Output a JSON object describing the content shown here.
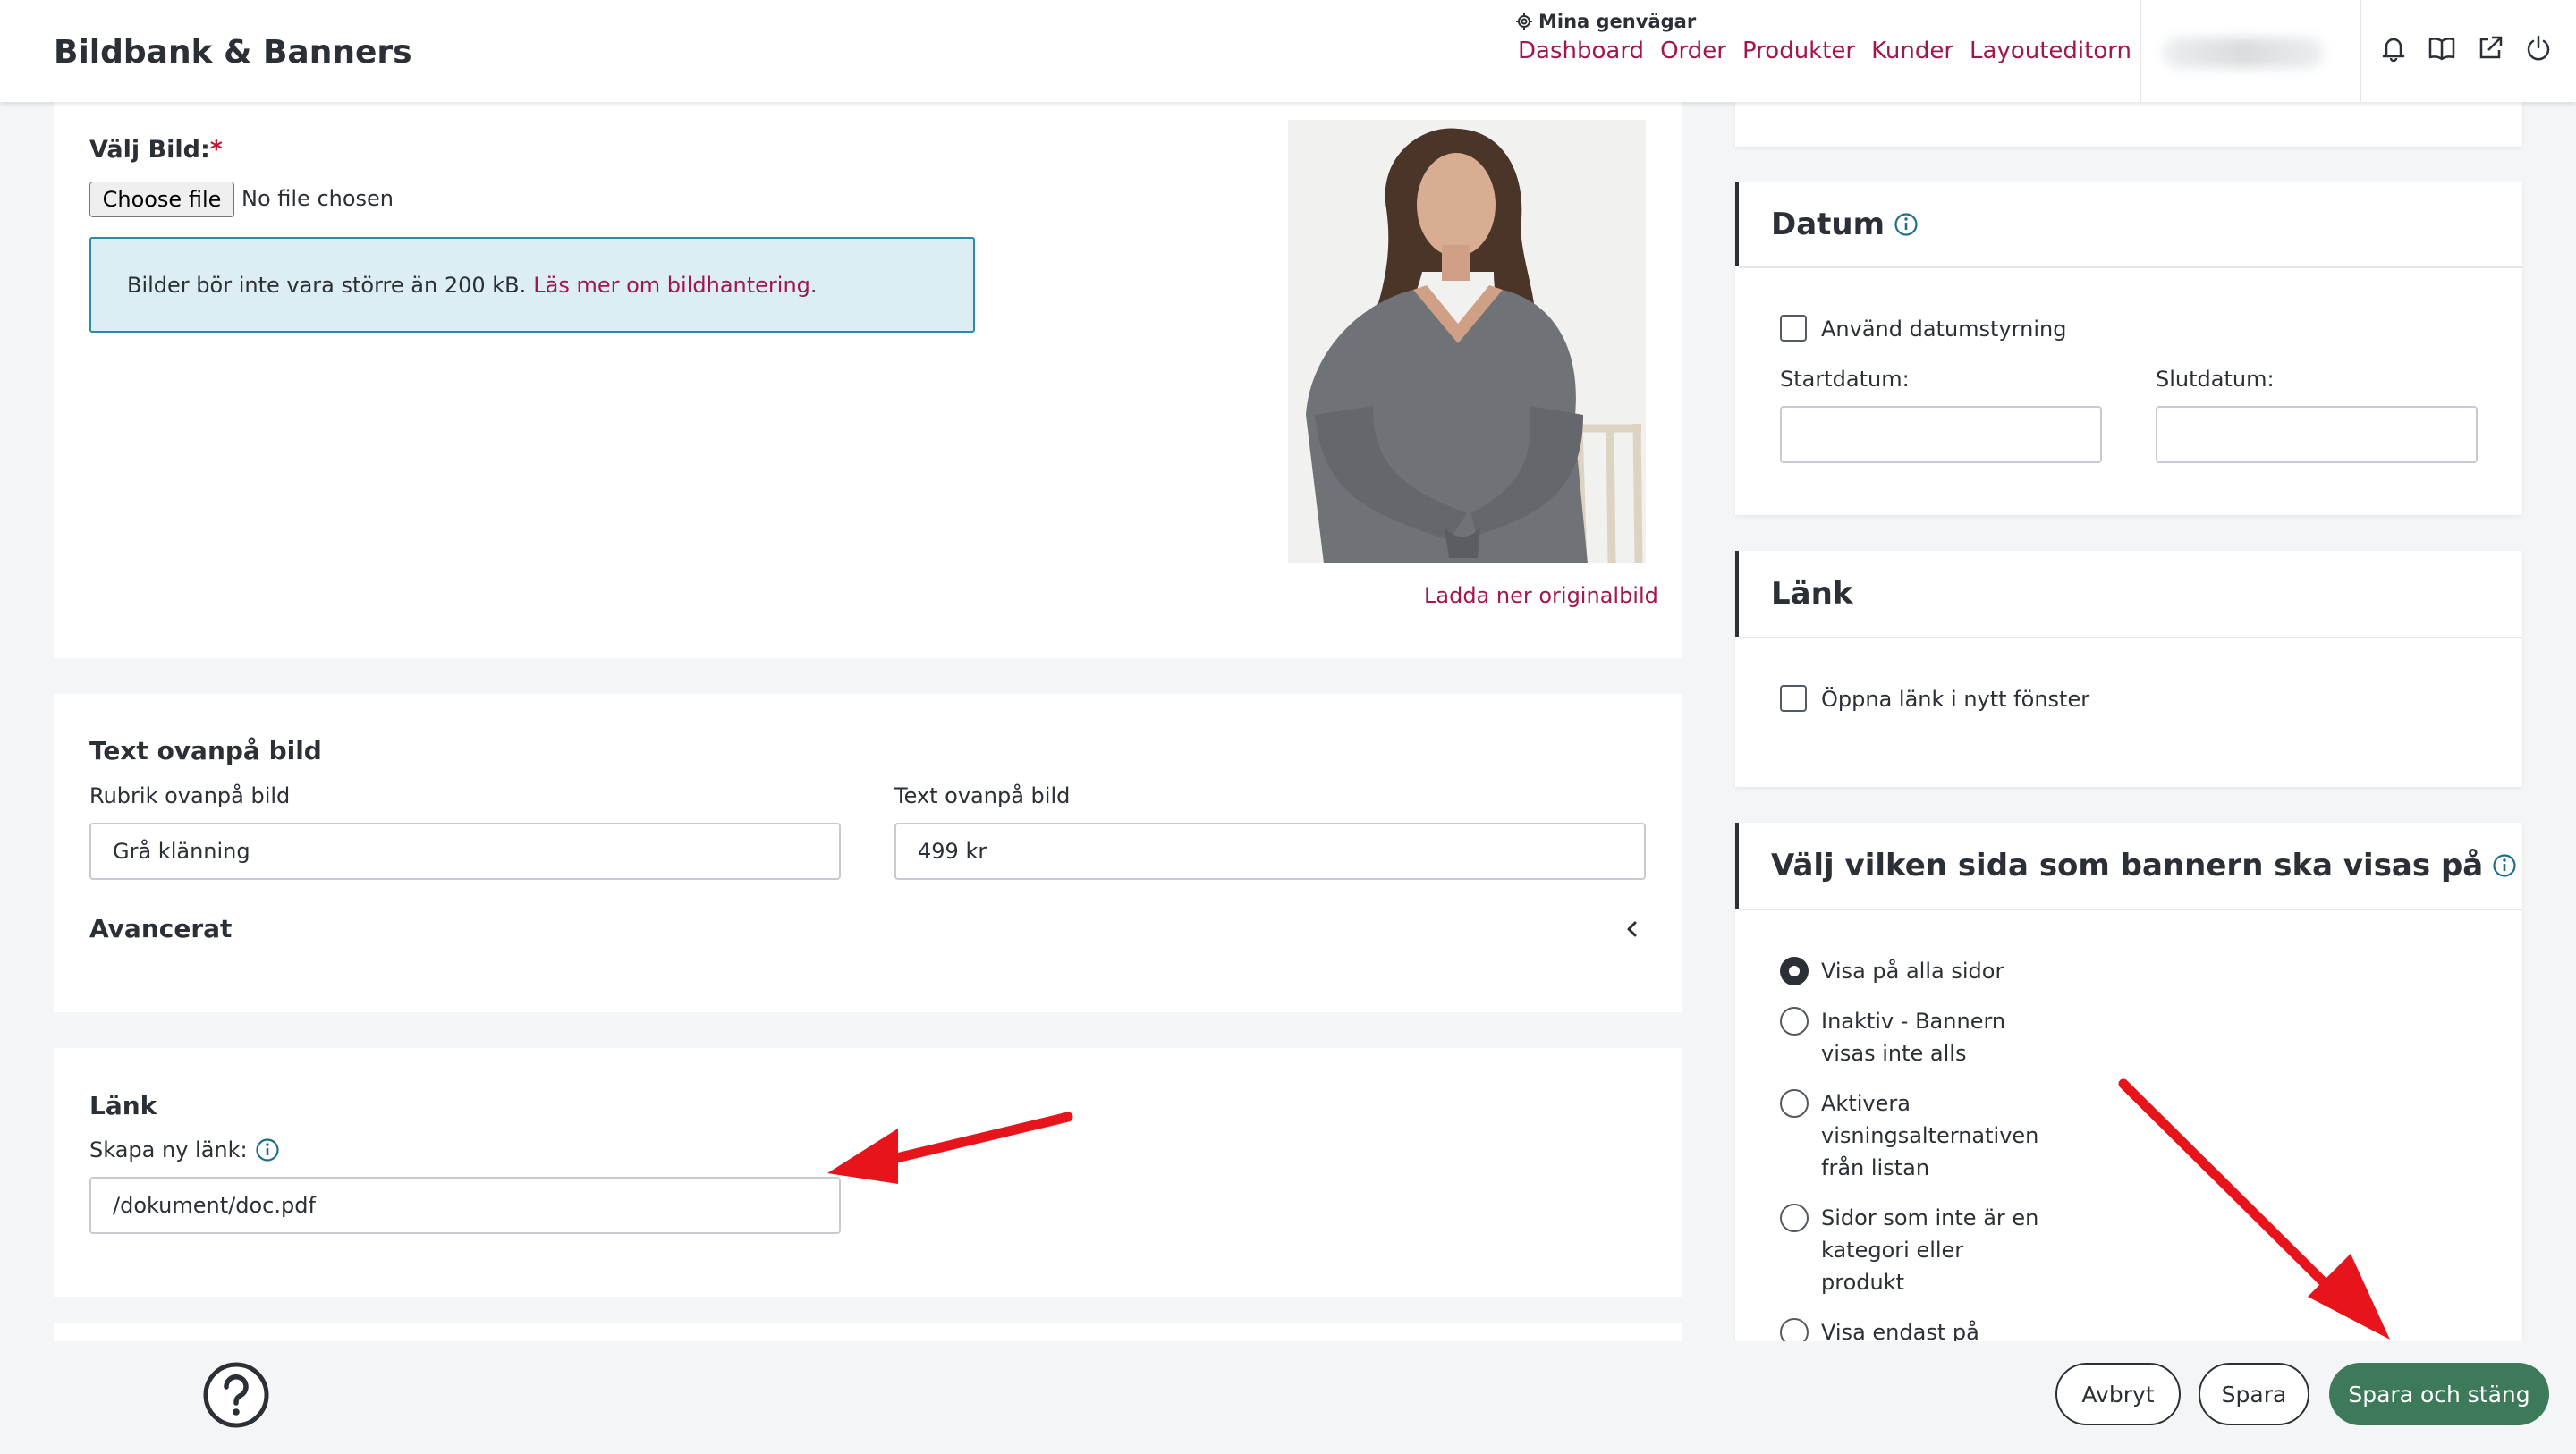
{
  "header": {
    "app_title": "Bildbank & Banners",
    "shortcuts_label": "Mina genvägar",
    "shortcuts": [
      "Dashboard",
      "Order",
      "Produkter",
      "Kunder",
      "Layouteditorn"
    ]
  },
  "image_section": {
    "label": "Välj Bild:",
    "required_mark": "*",
    "file_button": "Choose file",
    "file_status": "No file chosen",
    "info_text": "Bilder bör inte vara större än 200 kB.",
    "info_link": "Läs mer om bildhantering.",
    "download_link": "Ladda ner originalbild"
  },
  "text_section": {
    "title": "Text ovanpå bild",
    "headline_label": "Rubrik ovanpå bild",
    "headline_value": "Grå klänning",
    "text_label": "Text ovanpå bild",
    "text_value": "499 kr",
    "advanced_label": "Avancerat"
  },
  "link_section": {
    "title": "Länk",
    "create_label": "Skapa ny länk:",
    "link_value": "/dokument/doc.pdf"
  },
  "date_card": {
    "title": "Datum",
    "checkbox_label": "Använd datumstyrning",
    "start_label": "Startdatum:",
    "end_label": "Slutdatum:",
    "start_value": "",
    "end_value": ""
  },
  "link_card": {
    "title": "Länk",
    "checkbox_label": "Öppna länk i nytt fönster"
  },
  "page_card": {
    "title": "Välj vilken sida som bannern ska visas på",
    "options": [
      {
        "lines": [
          "Visa på alla sidor"
        ],
        "selected": true
      },
      {
        "lines": [
          "Inaktiv - Bannern",
          "visas inte alls"
        ],
        "selected": false
      },
      {
        "lines": [
          "Aktivera",
          "visningsalternativen",
          "från listan"
        ],
        "selected": false
      },
      {
        "lines": [
          "Sidor som inte är en",
          "kategori eller",
          "produkt"
        ],
        "selected": false
      },
      {
        "lines": [
          "Visa endast på"
        ],
        "selected": false
      }
    ]
  },
  "footer": {
    "cancel": "Avbryt",
    "save": "Spara",
    "save_close": "Spara och stäng"
  },
  "colors": {
    "accent_link": "#a0174f",
    "primary_button": "#3c7a5a",
    "info_bg": "#ddeef3",
    "annotation_arrow": "#e8141b"
  }
}
